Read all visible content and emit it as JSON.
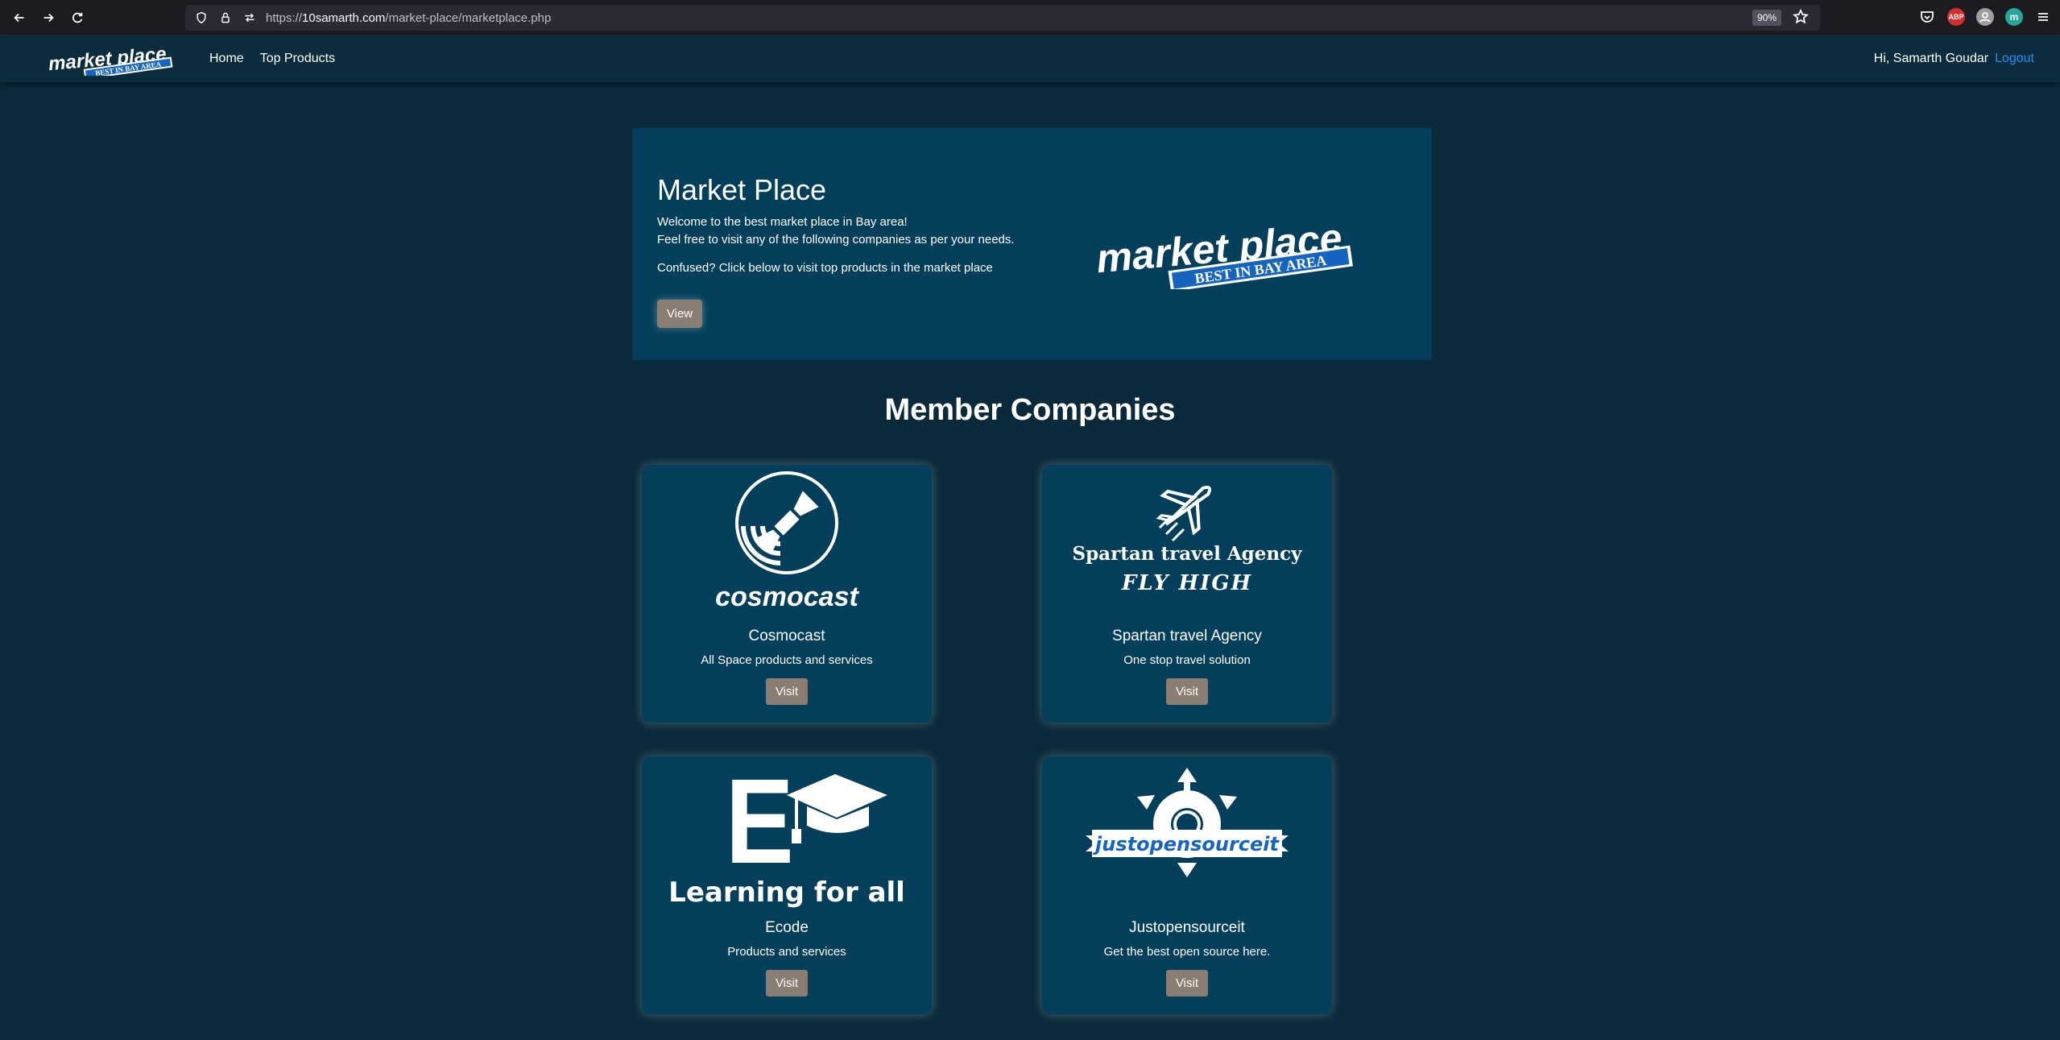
{
  "browser": {
    "url_prefix": "https://",
    "url_host": "10samarth.com",
    "url_path": "/market-place/marketplace.php",
    "zoom": "90%",
    "ext_abp": "ABP",
    "ext_m": "m"
  },
  "nav": {
    "logo_text": "market place",
    "logo_tagline": "BEST IN BAY AREA",
    "links": [
      "Home",
      "Top Products"
    ],
    "greeting": "Hi, Samarth Goudar",
    "logout": "Logout"
  },
  "hero": {
    "title": "Market Place",
    "line1": "Welcome to the best market place in Bay area!",
    "line2": "Feel free to visit any of the following companies as per your needs.",
    "line3": "Confused? Click below to visit top products in the market place",
    "button": "View",
    "logo_text": "market place",
    "logo_tagline": "BEST IN BAY AREA"
  },
  "section_title": "Member Companies",
  "companies": [
    {
      "name": "Cosmocast",
      "desc": "All Space products and services",
      "button": "Visit",
      "logo_text": "cosmocast",
      "logo_icon": "satellite-icon"
    },
    {
      "name": "Spartan travel Agency",
      "desc": "One stop travel solution",
      "button": "Visit",
      "logo_text": "Spartan travel Agency",
      "logo_sub": "FLY HIGH",
      "logo_icon": "airplane-icon"
    },
    {
      "name": "Ecode",
      "desc": "Products and services",
      "button": "Visit",
      "logo_text": "Learning for all",
      "logo_letter": "E",
      "logo_icon": "graduation-cap-icon"
    },
    {
      "name": "Justopensourceit",
      "desc": "Get the best open source here.",
      "button": "Visit",
      "logo_text": "justopensourceit",
      "logo_icon": "gear-arrows-icon"
    }
  ],
  "colors": {
    "page_bg": "#0a2a3b",
    "panel_bg": "#033e5a",
    "button_bg": "#8a7d72",
    "link_blue": "#1e90ff",
    "logo_blue": "#1565c0"
  }
}
